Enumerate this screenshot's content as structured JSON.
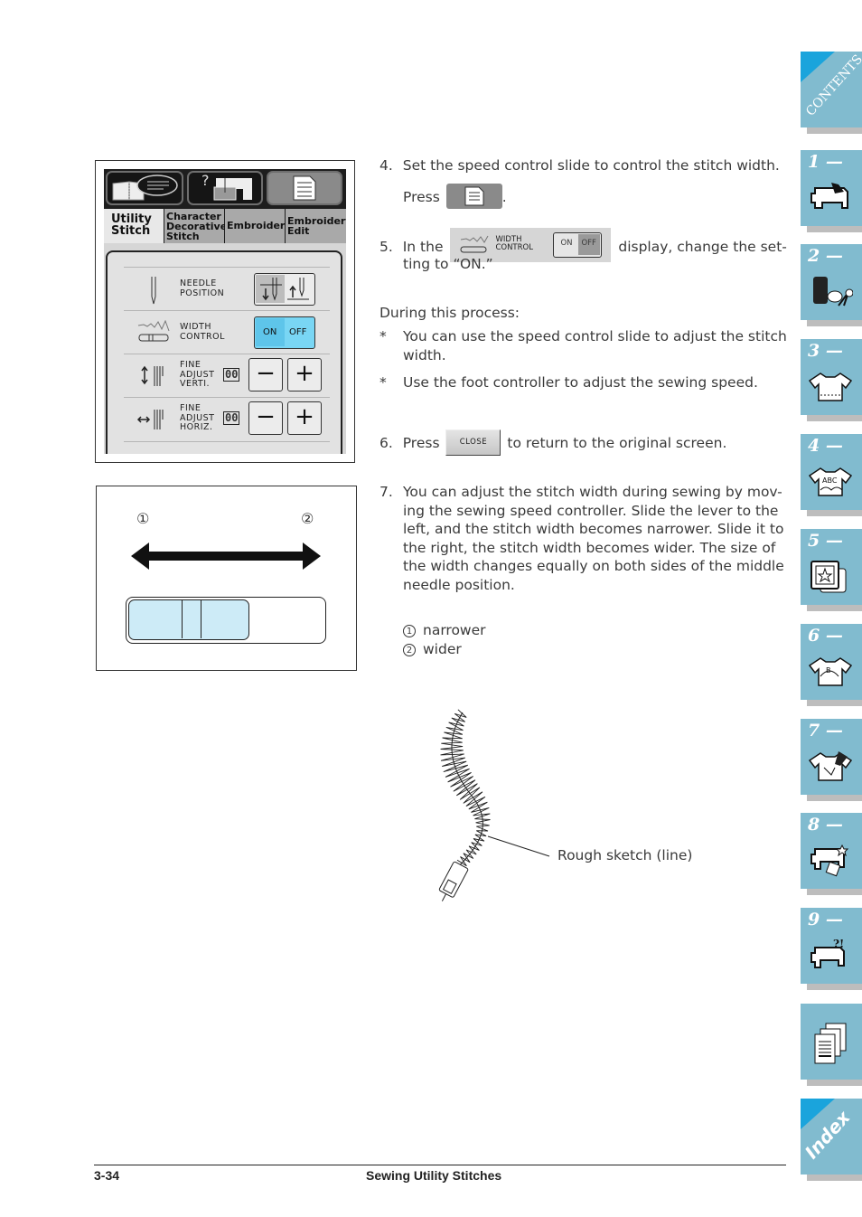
{
  "screen": {
    "tabs": [
      {
        "label_lines": [
          "Utility",
          "Stitch"
        ],
        "selected": true
      },
      {
        "label_lines": [
          "Character",
          "Decorative",
          "Stitch"
        ],
        "selected": false
      },
      {
        "label_lines": [
          "Embroidery"
        ],
        "selected": false
      },
      {
        "label_lines": [
          "Embroidery",
          "Edit"
        ],
        "selected": false
      }
    ],
    "top_buttons": [
      "help-book-icon",
      "machine-help-icon",
      "settings-list-icon"
    ],
    "rows": [
      {
        "label_lines": [
          "NEEDLE",
          "POSITION"
        ],
        "icon": "needle-icon",
        "control": "needle-position-toggle"
      },
      {
        "label_lines": [
          "WIDTH",
          "CONTROL"
        ],
        "icon": "width-control-icon",
        "on": "ON",
        "off": "OFF",
        "state": "ON"
      },
      {
        "label_lines": [
          "FINE",
          "ADJUST",
          "VERTI."
        ],
        "icon": "vertical-adjust-icon",
        "value": "00",
        "minus": "−",
        "plus": "+"
      },
      {
        "label_lines": [
          "FINE",
          "ADJUST",
          "HORIZ."
        ],
        "icon": "horizontal-adjust-icon",
        "value": "00",
        "minus": "−",
        "plus": "+"
      }
    ]
  },
  "slider_figure": {
    "marker_left": "①",
    "marker_right": "②",
    "slider_level_fraction": 0.62
  },
  "steps": {
    "step4": {
      "num": "4.",
      "text": "Set the speed control slide to control the stitch width.",
      "press": "Press",
      "after": "."
    },
    "step5": {
      "num": "5.",
      "pre": "In the",
      "post": "display, change the set-",
      "cont": "ting to “ON.”",
      "inline_label_1": "WIDTH",
      "inline_label_2": "CONTROL",
      "inline_on": "ON",
      "inline_off": "OFF"
    },
    "during": "During this process:",
    "bullets": [
      {
        "mark": "*",
        "lines": [
          "You can use the speed control slide to adjust the stitch",
          "width."
        ]
      },
      {
        "mark": "*",
        "lines": [
          "Use the foot controller to adjust the sewing speed."
        ]
      }
    ],
    "step6": {
      "num": "6.",
      "press": "Press",
      "button": "CLOSE",
      "after": "to return to the original screen."
    },
    "step7": {
      "num": "7.",
      "lines": [
        "You can adjust the stitch width during sewing by mov-",
        "ing the sewing speed controller. Slide the lever to the",
        "left, and the stitch width becomes narrower. Slide it to",
        "the right, the stitch width becomes wider. The size of",
        "the width changes equally on both sides of the middle",
        "needle position."
      ]
    },
    "legend": [
      {
        "mark": "1",
        "text": "narrower"
      },
      {
        "mark": "2",
        "text": "wider"
      }
    ]
  },
  "sketch_caption": "Rough sketch (line)",
  "sidebar": {
    "contents": "CONTENTS",
    "chapters": [
      {
        "num": "1 —",
        "icon": "sewing-machine-hand-icon"
      },
      {
        "num": "2 —",
        "icon": "thread-spool-scissors-icon"
      },
      {
        "num": "3 —",
        "icon": "shirt-stitch-icon"
      },
      {
        "num": "4 —",
        "icon": "shirt-abc-icon"
      },
      {
        "num": "5 —",
        "icon": "embroidery-frame-icon"
      },
      {
        "num": "6 —",
        "icon": "shirt-edit-icon"
      },
      {
        "num": "7 —",
        "icon": "shirt-pen-icon"
      },
      {
        "num": "8 —",
        "icon": "machine-care-icon"
      },
      {
        "num": "9 —",
        "icon": "machine-trouble-icon"
      }
    ],
    "index": "Index"
  },
  "footer": {
    "page": "3-34",
    "title": "Sewing Utility Stitches"
  }
}
